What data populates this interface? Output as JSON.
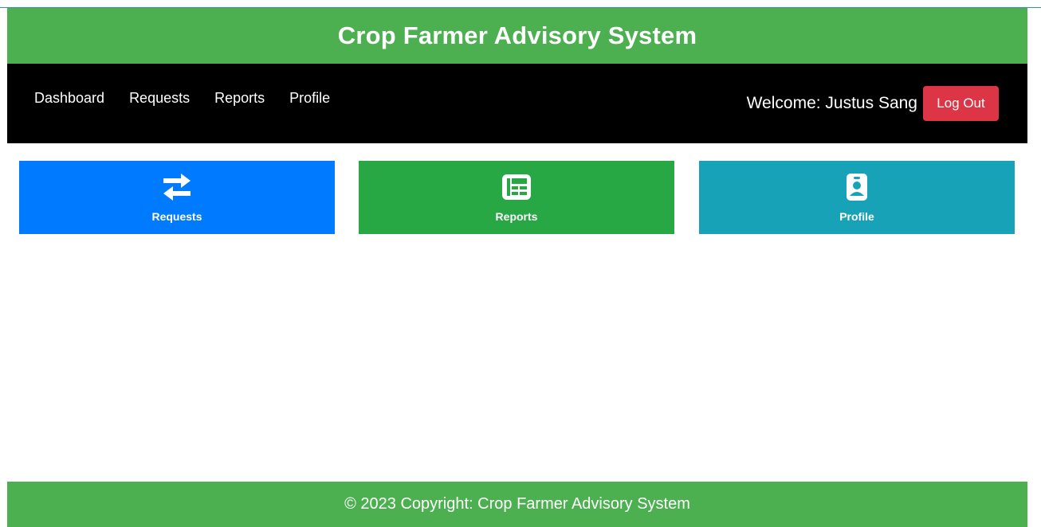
{
  "header": {
    "title": "Crop Farmer Advisory System"
  },
  "nav": {
    "links": [
      "Dashboard",
      "Requests",
      "Reports",
      "Profile"
    ],
    "welcome": "Welcome: Justus Sang",
    "logout_label": "Log Out"
  },
  "cards": [
    {
      "label": "Requests",
      "icon": "exchange-arrows-icon",
      "color": "#007bff"
    },
    {
      "label": "Reports",
      "icon": "newspaper-icon",
      "color": "#28a745"
    },
    {
      "label": "Profile",
      "icon": "id-badge-icon",
      "color": "#17a2b8"
    }
  ],
  "footer": {
    "text": "© 2023 Copyright: Crop Farmer Advisory System"
  },
  "colors": {
    "brand_green": "#4cb050",
    "navbar": "#000000",
    "logout": "#dc3545"
  }
}
